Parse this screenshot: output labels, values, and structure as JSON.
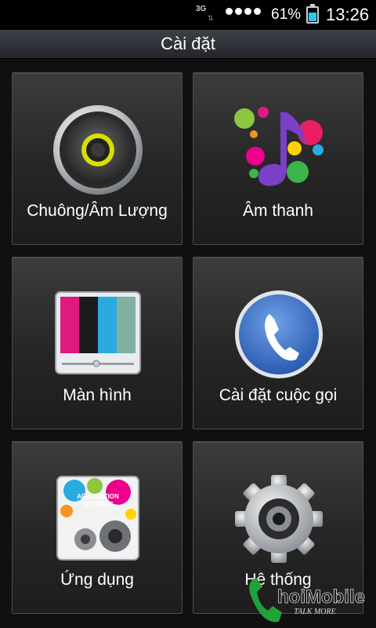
{
  "status_bar": {
    "network": "3G",
    "battery_percent": "61%",
    "battery_level": 0.61,
    "time": "13:26"
  },
  "header": {
    "title": "Cài đặt"
  },
  "tiles": [
    {
      "label": "Chuông/Âm Lượng",
      "icon": "speaker-icon"
    },
    {
      "label": "Âm thanh",
      "icon": "music-note-icon"
    },
    {
      "label": "Màn hình",
      "icon": "display-icon"
    },
    {
      "label": "Cài đặt cuộc gọi",
      "icon": "phone-icon"
    },
    {
      "label": "Ứng dụng",
      "icon": "applications-icon"
    },
    {
      "label": "Hệ thống",
      "icon": "gear-icon"
    }
  ],
  "icon_text": {
    "applications_line1": "APPLICATION",
    "applications_line2": "SETTINGS"
  },
  "watermark": {
    "brand": "hoiMobile",
    "tagline": "TALK MORE"
  },
  "colors": {
    "accent": "#2fc3f0",
    "title_bar": "#2f3137",
    "tile": "#2a2a2a"
  }
}
